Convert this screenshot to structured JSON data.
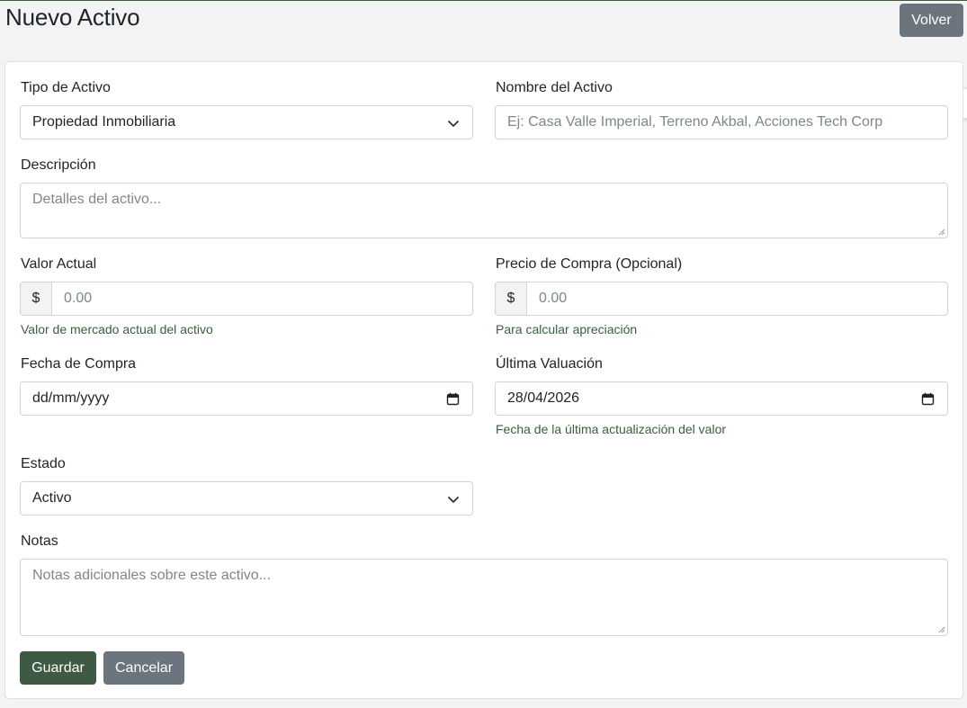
{
  "page": {
    "title": "Nuevo Activo",
    "back_label": "Volver"
  },
  "form": {
    "tipo": {
      "label": "Tipo de Activo",
      "value": "Propiedad Inmobiliaria"
    },
    "nombre": {
      "label": "Nombre del Activo",
      "placeholder": "Ej: Casa Valle Imperial, Terreno Akbal, Acciones Tech Corp"
    },
    "descripcion": {
      "label": "Descripción",
      "placeholder": "Detalles del activo..."
    },
    "valor_actual": {
      "label": "Valor Actual",
      "prefix": "$",
      "placeholder": "0.00",
      "help": "Valor de mercado actual del activo"
    },
    "precio_compra": {
      "label": "Precio de Compra (Opcional)",
      "prefix": "$",
      "placeholder": "0.00",
      "help": "Para calcular apreciación"
    },
    "fecha_compra": {
      "label": "Fecha de Compra",
      "value": "dd/mm/yyyy"
    },
    "ultima_valuacion": {
      "label": "Última Valuación",
      "value": "28/04/2026",
      "help": "Fecha de la última actualización del valor"
    },
    "estado": {
      "label": "Estado",
      "value": "Activo"
    },
    "notas": {
      "label": "Notas",
      "placeholder": "Notas adicionales sobre este activo..."
    }
  },
  "actions": {
    "save_label": "Guardar",
    "cancel_label": "Cancelar"
  },
  "colors": {
    "primary": "#3f5a42",
    "secondary": "#6c757d",
    "help_text": "#3a5e3c"
  }
}
